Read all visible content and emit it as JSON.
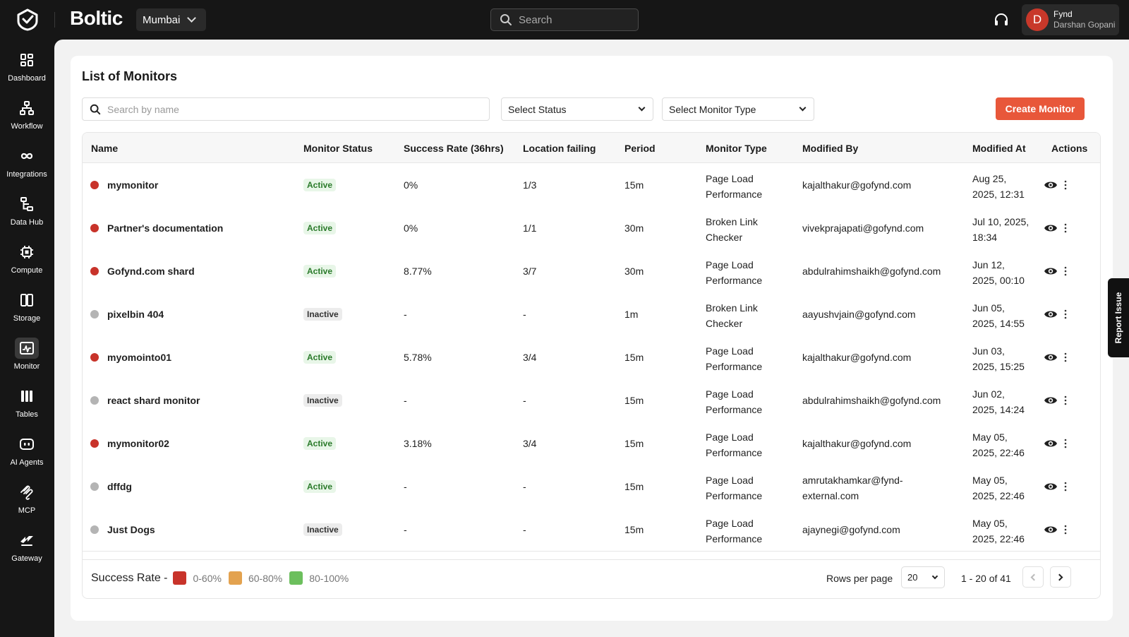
{
  "topbar": {
    "brand": "Boltic",
    "region": "Mumbai",
    "search_placeholder": "Search",
    "user": {
      "initial": "D",
      "org": "Fynd",
      "name": "Darshan Gopani"
    }
  },
  "sidebar": {
    "items": [
      {
        "label": "Dashboard",
        "icon": "dashboard-icon"
      },
      {
        "label": "Workflow",
        "icon": "workflow-icon"
      },
      {
        "label": "Integrations",
        "icon": "integrations-icon"
      },
      {
        "label": "Data Hub",
        "icon": "data-hub-icon"
      },
      {
        "label": "Compute",
        "icon": "compute-icon"
      },
      {
        "label": "Storage",
        "icon": "storage-icon"
      },
      {
        "label": "Monitor",
        "icon": "monitor-icon",
        "active": true
      },
      {
        "label": "Tables",
        "icon": "tables-icon"
      },
      {
        "label": "AI Agents",
        "icon": "ai-agents-icon"
      },
      {
        "label": "MCP",
        "icon": "mcp-icon"
      },
      {
        "label": "Gateway",
        "icon": "gateway-icon"
      }
    ]
  },
  "main": {
    "title": "List of Monitors",
    "search_placeholder": "Search by name",
    "status_select": "Select Status",
    "type_select": "Select Monitor Type",
    "create_label": "Create Monitor"
  },
  "table": {
    "columns": [
      "Name",
      "Monitor Status",
      "Success Rate (36hrs)",
      "Location failing",
      "Period",
      "Monitor Type",
      "Modified By",
      "Modified At",
      "Actions"
    ],
    "rows": [
      {
        "name": "mymonitor",
        "dot": "red",
        "status": "Active",
        "rate": "0%",
        "loc": "1/3",
        "period": "15m",
        "type1": "Page Load",
        "type2": "Performance",
        "by1": "kajalthakur@gofynd.com",
        "by2": "",
        "at1": "Aug 25,",
        "at2": "2025, 12:31"
      },
      {
        "name": "Partner's documentation",
        "dot": "red",
        "status": "Active",
        "rate": "0%",
        "loc": "1/1",
        "period": "30m",
        "type1": "Broken Link",
        "type2": "Checker",
        "by1": "vivekprajapati@gofynd.com",
        "by2": "",
        "at1": "Jul 10, 2025,",
        "at2": "18:34"
      },
      {
        "name": "Gofynd.com shard",
        "dot": "red",
        "status": "Active",
        "rate": "8.77%",
        "loc": "3/7",
        "period": "30m",
        "type1": "Page Load",
        "type2": "Performance",
        "by1": "abdulrahimshaikh@gofynd.com",
        "by2": "",
        "at1": "Jun 12,",
        "at2": "2025, 00:10"
      },
      {
        "name": "pixelbin 404",
        "dot": "grey",
        "status": "Inactive",
        "rate": "-",
        "loc": "-",
        "period": "1m",
        "type1": "Broken Link",
        "type2": "Checker",
        "by1": "aayushvjain@gofynd.com",
        "by2": "",
        "at1": "Jun 05,",
        "at2": "2025, 14:55"
      },
      {
        "name": "myomointo01",
        "dot": "red",
        "status": "Active",
        "rate": "5.78%",
        "loc": "3/4",
        "period": "15m",
        "type1": "Page Load",
        "type2": "Performance",
        "by1": "kajalthakur@gofynd.com",
        "by2": "",
        "at1": "Jun 03,",
        "at2": "2025, 15:25"
      },
      {
        "name": "react shard monitor",
        "dot": "grey",
        "status": "Inactive",
        "rate": "-",
        "loc": "-",
        "period": "15m",
        "type1": "Page Load",
        "type2": "Performance",
        "by1": "abdulrahimshaikh@gofynd.com",
        "by2": "",
        "at1": "Jun 02,",
        "at2": "2025, 14:24"
      },
      {
        "name": "mymonitor02",
        "dot": "red",
        "status": "Active",
        "rate": "3.18%",
        "loc": "3/4",
        "period": "15m",
        "type1": "Page Load",
        "type2": "Performance",
        "by1": "kajalthakur@gofynd.com",
        "by2": "",
        "at1": "May 05,",
        "at2": "2025, 22:46"
      },
      {
        "name": "dffdg",
        "dot": "grey",
        "status": "Active",
        "rate": "-",
        "loc": "-",
        "period": "15m",
        "type1": "Page Load",
        "type2": "Performance",
        "by1": "amrutakhamkar@fynd-",
        "by2": "external.com",
        "at1": "May 05,",
        "at2": "2025, 22:46"
      },
      {
        "name": "Just Dogs",
        "dot": "grey",
        "status": "Inactive",
        "rate": "-",
        "loc": "-",
        "period": "15m",
        "type1": "Page Load",
        "type2": "Performance",
        "by1": "ajaynegi@gofynd.com",
        "by2": "",
        "at1": "May 05,",
        "at2": "2025, 22:46"
      }
    ]
  },
  "footer": {
    "legend_label": "Success Rate -",
    "legend": [
      {
        "range": "0-60%",
        "color": "#c8332a"
      },
      {
        "range": "60-80%",
        "color": "#e3a24f"
      },
      {
        "range": "80-100%",
        "color": "#6cbf5d"
      }
    ],
    "rows_label": "Rows per page",
    "rows_value": "20",
    "page_info": "1 - 20 of 41"
  },
  "report_issue": "Report Issue",
  "colors": {
    "accent": "#e8573a",
    "sidebar_bg": "#161616"
  }
}
